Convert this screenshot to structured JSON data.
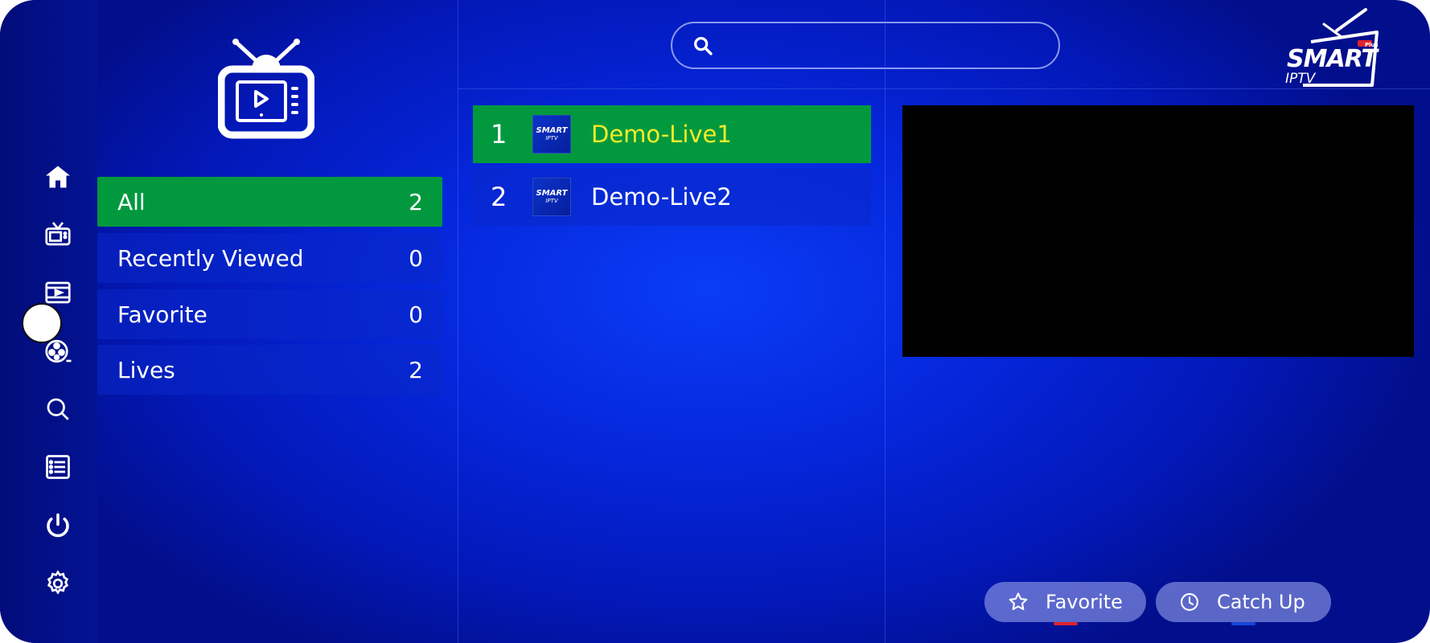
{
  "rail": {
    "items": [
      {
        "name": "home"
      },
      {
        "name": "live-tv"
      },
      {
        "name": "movies"
      },
      {
        "name": "series"
      },
      {
        "name": "search"
      },
      {
        "name": "list"
      },
      {
        "name": "power"
      },
      {
        "name": "settings"
      }
    ]
  },
  "categories": [
    {
      "label": "All",
      "count": "2"
    },
    {
      "label": "Recently Viewed",
      "count": "0"
    },
    {
      "label": "Favorite",
      "count": "0"
    },
    {
      "label": "Lives",
      "count": "2"
    }
  ],
  "search": {
    "placeholder": "",
    "value": ""
  },
  "channels": [
    {
      "num": "1",
      "name": "Demo-Live1",
      "thumb_line1": "SMART",
      "thumb_line2": "IPTV"
    },
    {
      "num": "2",
      "name": "Demo-Live2",
      "thumb_line1": "SMART",
      "thumb_line2": "IPTV"
    }
  ],
  "brand": {
    "line1": "SMART",
    "line2": "IPTV",
    "badge": "Plus"
  },
  "buttons": {
    "favorite": "Favorite",
    "catchup": "Catch Up"
  },
  "colors": {
    "active": "#02993e",
    "active_text": "#f4ec2a",
    "background": "#0527dc"
  }
}
